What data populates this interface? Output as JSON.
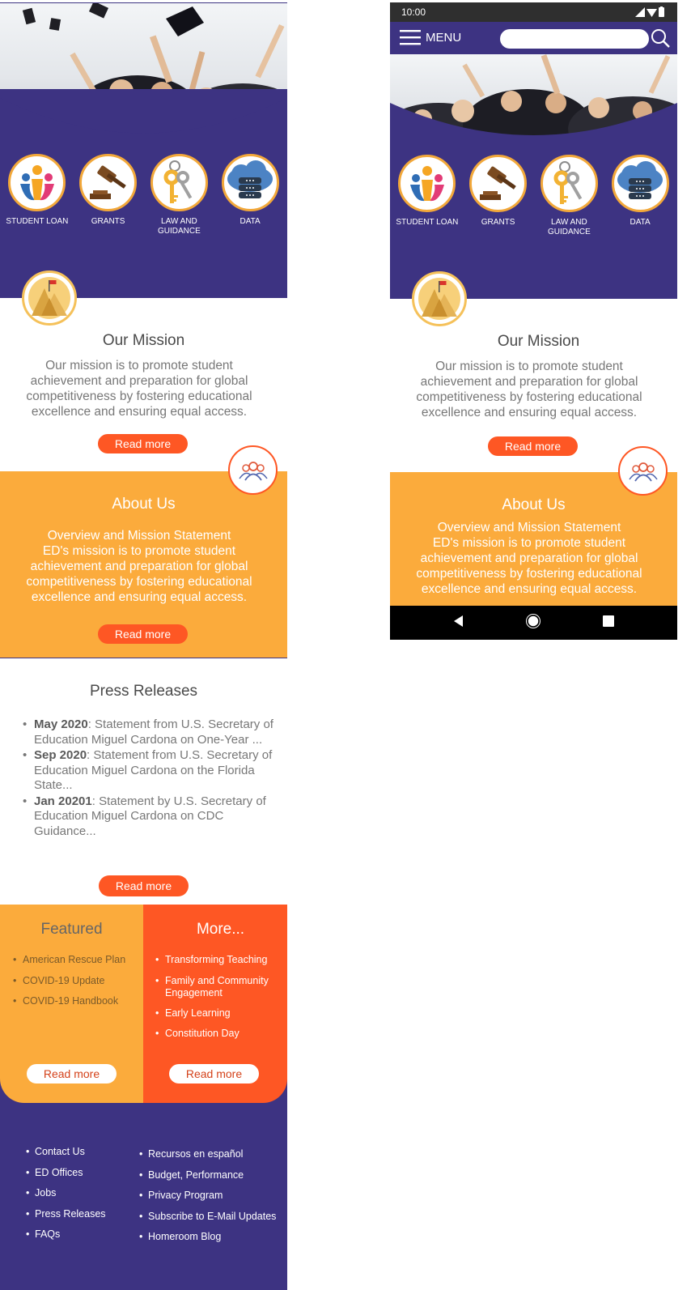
{
  "nav": {
    "items": [
      {
        "label": "STUDENT LOAN",
        "icon": "people-icon"
      },
      {
        "label": "GRANTS",
        "icon": "gavel-icon"
      },
      {
        "label": "LAW AND GUIDANCE",
        "icon": "keys-icon"
      },
      {
        "label": "DATA",
        "icon": "cloud-database-icon"
      }
    ]
  },
  "mission": {
    "title": "Our Mission",
    "body": "Our mission is to promote student achievement and preparation for global competitiveness by fostering educational excellence and ensuring equal access.",
    "button": "Read more"
  },
  "about": {
    "title": "About Us",
    "subtitle": "Overview and Mission Statement",
    "body": "ED's mission is to promote student achievement and preparation for global competitiveness by fostering educational excellence and ensuring equal access.",
    "button": "Read more"
  },
  "press": {
    "title": "Press Releases",
    "items": [
      {
        "date": "May 2020",
        "text": ": Statement from U.S. Secretary of Education Miguel Cardona on One-Year ..."
      },
      {
        "date": "Sep 2020",
        "text": ": Statement from U.S. Secretary of Education Miguel Cardona on the Florida State..."
      },
      {
        "date": "Jan 20201",
        "text": ": Statement by U.S. Secretary of Education Miguel Cardona on CDC Guidance..."
      }
    ],
    "button": "Read more"
  },
  "featured": {
    "title": "Featured",
    "items": [
      "American Rescue Plan",
      "COVID-19 Update",
      "COVID-19 Handbook"
    ],
    "button": "Read more"
  },
  "more": {
    "title": "More...",
    "items": [
      "Transforming Teaching",
      "Family and Community Engagement",
      "Early Learning",
      "Constitution Day"
    ],
    "button": "Read more"
  },
  "footer": {
    "left": [
      "Contact Us",
      "ED Offices",
      "Jobs",
      "Press Releases",
      "FAQs"
    ],
    "right": [
      "Recursos en español",
      "Budget, Performance",
      "Privacy Program",
      "Subscribe to E-Mail Updates",
      "Homeroom Blog"
    ]
  },
  "phone": {
    "time": "10:00",
    "menu_label": "MENU",
    "search_placeholder": ""
  },
  "colors": {
    "purple": "#3d3382",
    "orange": "#fbab3c",
    "red_orange": "#fe5724"
  }
}
